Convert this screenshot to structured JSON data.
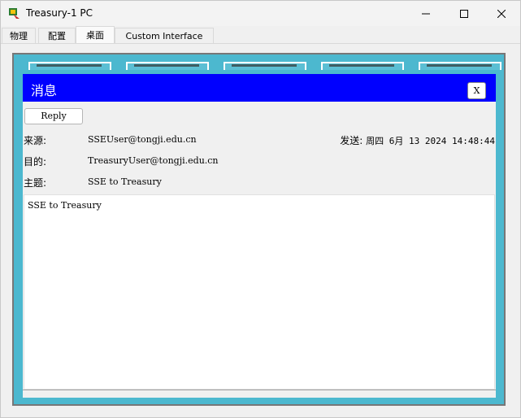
{
  "window": {
    "title": "Treasury-1 PC"
  },
  "tabs": [
    {
      "label": "物理"
    },
    {
      "label": "配置"
    },
    {
      "label": "桌面"
    },
    {
      "label": "Custom Interface"
    }
  ],
  "message": {
    "header_title": "消息",
    "close_label": "X",
    "reply_label": "Reply",
    "from_label": "来源:",
    "from_value": "SSEUser@tongji.edu.cn",
    "sent_label": "发送:",
    "sent_value": "周四 6月 13 2024 14:48:44",
    "to_label": "目的:",
    "to_value": "TreasuryUser@tongji.edu.cn",
    "subject_label": "主题:",
    "subject_value": "SSE to Treasury",
    "body": "SSE to Treasury"
  },
  "colors": {
    "desktop_bg": "#4cb8cf",
    "message_header": "#0000ff"
  }
}
